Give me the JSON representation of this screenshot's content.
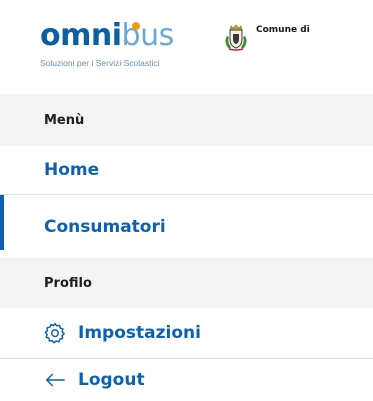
{
  "header": {
    "logo": {
      "part1": "omn",
      "part2": "i",
      "part3": "bus",
      "tagline": "Soluzioni per i Servizi Scolastici"
    },
    "crest_icon": "municipal-crest-icon",
    "municipality_label": "Comune di"
  },
  "menu": {
    "section_menu": "Menù",
    "items_top": [
      {
        "label": "Home"
      },
      {
        "label": "Consumatori",
        "active": true
      }
    ],
    "section_profile": "Profilo",
    "items_profile": [
      {
        "label": "Impostazioni",
        "icon": "gear-icon"
      },
      {
        "label": "Logout",
        "icon": "arrow-left-icon"
      }
    ]
  },
  "colors": {
    "primary": "#0b62b0",
    "logo_light": "#6aa8d8",
    "logo_dot": "#f39c12",
    "section_bg": "#f4f4f4"
  }
}
